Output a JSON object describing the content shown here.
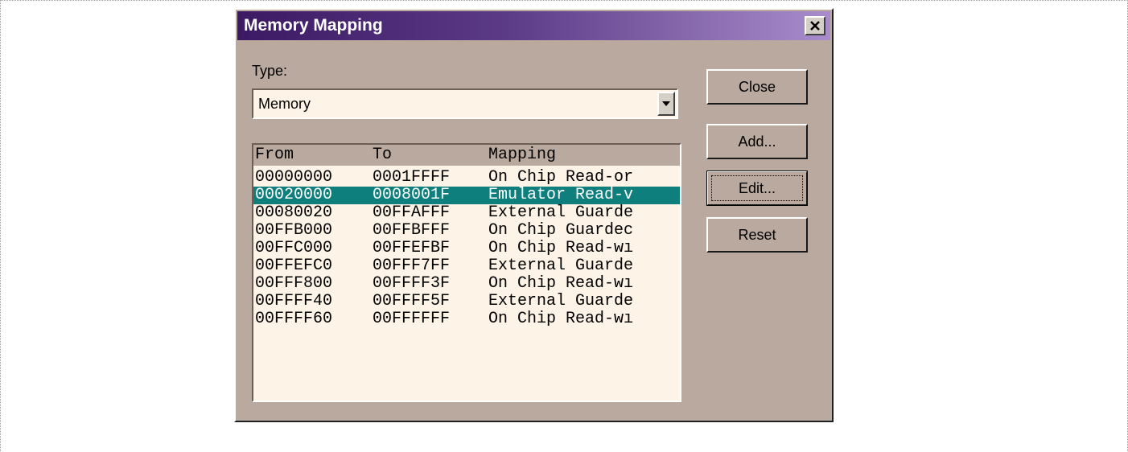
{
  "window": {
    "title": "Memory Mapping"
  },
  "type": {
    "label": "Type:",
    "selected": "Memory"
  },
  "list": {
    "headers": {
      "from": "From",
      "to": "To",
      "mapping": "Mapping"
    },
    "rows": [
      {
        "from": "00000000",
        "to": "0001FFFF",
        "mapping": "On Chip Read-or"
      },
      {
        "from": "00020000",
        "to": "0008001F",
        "mapping": "Emulator Read-v"
      },
      {
        "from": "00080020",
        "to": "00FFAFFF",
        "mapping": "External Guarde"
      },
      {
        "from": "00FFB000",
        "to": "00FFBFFF",
        "mapping": "On Chip Guardec"
      },
      {
        "from": "00FFC000",
        "to": "00FFEFBF",
        "mapping": "On Chip Read-wı"
      },
      {
        "from": "00FFEFC0",
        "to": "00FFF7FF",
        "mapping": "External Guarde"
      },
      {
        "from": "00FFF800",
        "to": "00FFFF3F",
        "mapping": "On Chip Read-wı"
      },
      {
        "from": "00FFFF40",
        "to": "00FFFF5F",
        "mapping": "External Guarde"
      },
      {
        "from": "00FFFF60",
        "to": "00FFFFFF",
        "mapping": "On Chip Read-wı"
      }
    ],
    "selected_index": 1
  },
  "buttons": {
    "close": "Close",
    "add": "Add...",
    "edit": "Edit...",
    "reset": "Reset"
  },
  "icons": {
    "window_close": "close-icon",
    "dropdown": "chevron-down-icon"
  },
  "colors": {
    "selection": "#0f7f7e",
    "dialog_bg": "#b9a99e",
    "field_bg": "#fdf3e6"
  }
}
